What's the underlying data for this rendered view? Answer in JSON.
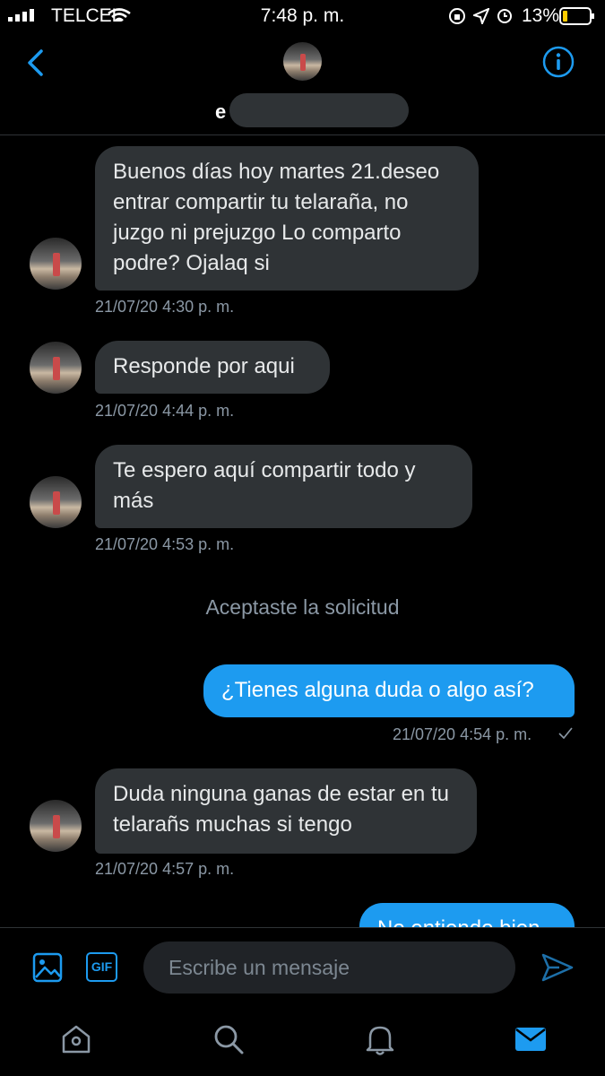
{
  "status_bar": {
    "carrier": "TELCEL",
    "time": "7:48 p. m.",
    "battery": "13%"
  },
  "header": {
    "name_visible_initial": "e"
  },
  "messages": [
    {
      "text": "Buenos días hoy martes 21.deseo entrar compartir tu telaraña, no juzgo ni prejuzgo Lo comparto podre? Ojalaq si",
      "timestamp": "21/07/20 4:30 p. m."
    },
    {
      "text": "Responde por aqui",
      "timestamp": "21/07/20 4:44 p. m."
    },
    {
      "text": "Te espero aquí compartir todo y más",
      "timestamp": "21/07/20 4:53 p. m."
    },
    {
      "system": "Aceptaste la solicitud"
    },
    {
      "text": "¿Tienes alguna duda o algo así?",
      "timestamp": "21/07/20 4:54 p. m."
    },
    {
      "text": "Duda ninguna ganas de estar en tu telarañs muchas si tengo",
      "timestamp": "21/07/20 4:57 p. m."
    },
    {
      "text": "No entiendo bien"
    }
  ],
  "composer": {
    "placeholder": "Escribe un mensaje",
    "gif_label": "GIF"
  },
  "colors": {
    "accent": "#1d9bf0",
    "incoming_bubble": "#2f3336",
    "background": "#000000"
  }
}
